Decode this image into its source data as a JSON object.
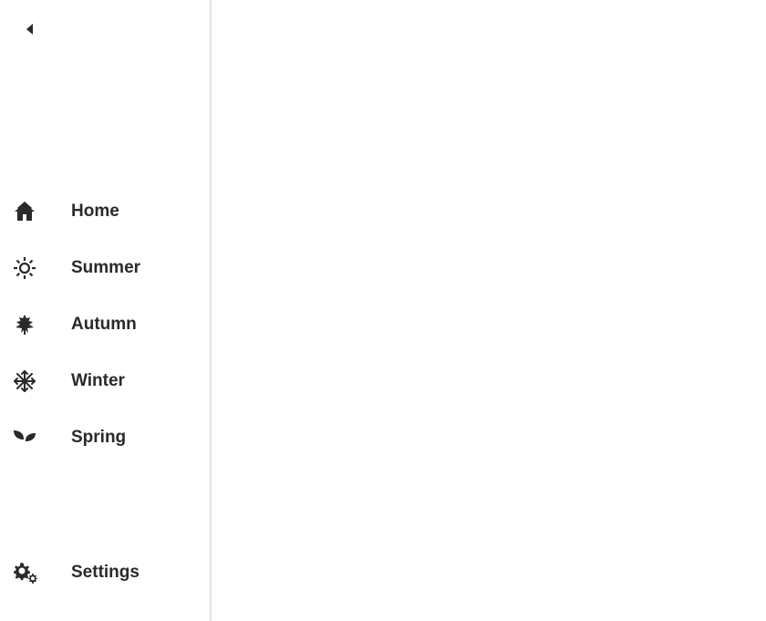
{
  "sidebar": {
    "items": [
      {
        "label": "Home"
      },
      {
        "label": "Summer"
      },
      {
        "label": "Autumn"
      },
      {
        "label": "Winter"
      },
      {
        "label": "Spring"
      }
    ],
    "footer": {
      "label": "Settings"
    }
  }
}
